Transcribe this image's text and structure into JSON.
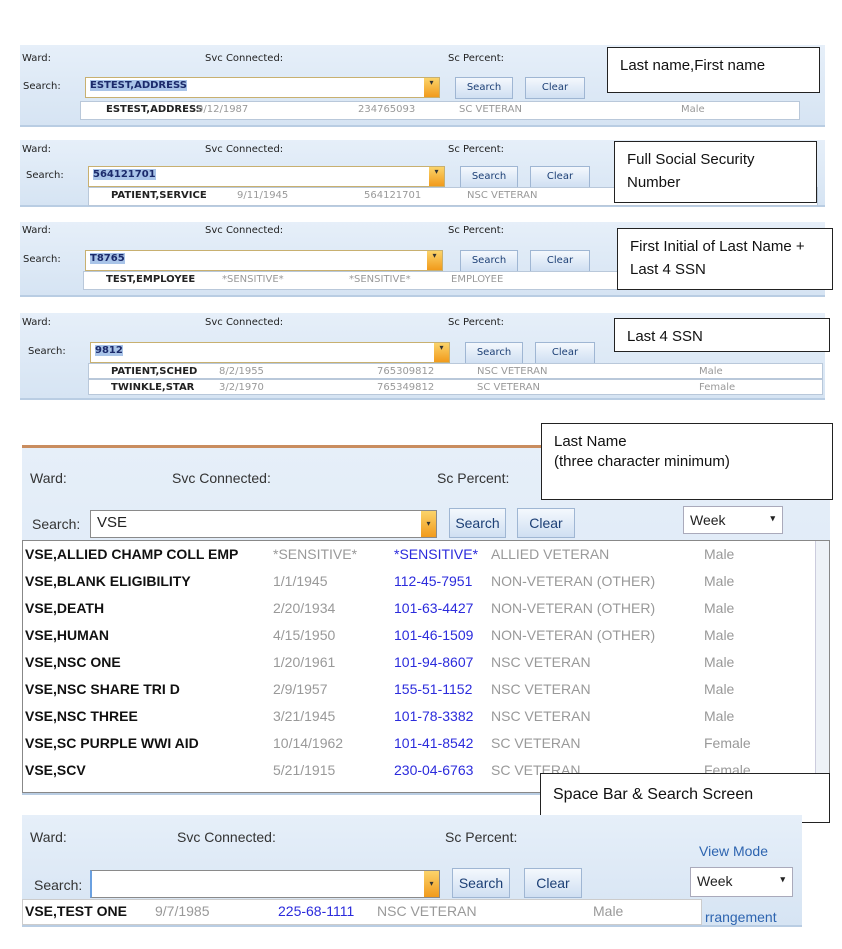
{
  "labels": {
    "ward": "Ward:",
    "svc": "Svc Connected:",
    "sc": "Sc Percent:",
    "search": "Search:",
    "search_btn": "Search",
    "clear_btn": "Clear",
    "dropdown_glyph": "▾"
  },
  "panels": [
    {
      "query": "ESTEST,ADDRESS",
      "callout": "Last name,First name",
      "results": [
        {
          "name": "ESTEST,ADDRESS",
          "dob": "9/12/1987",
          "ssn": "234765093",
          "type": "SC VETERAN",
          "gender": "Male"
        }
      ]
    },
    {
      "query": "564121701",
      "callout": "Full Social Security Number",
      "results": [
        {
          "name": "PATIENT,SERVICE",
          "dob": "9/11/1945",
          "ssn": "564121701",
          "type": "NSC VETERAN",
          "gender": ""
        }
      ]
    },
    {
      "query": "T8765",
      "callout": "First Initial of Last Name + Last 4 SSN",
      "results": [
        {
          "name": "TEST,EMPLOYEE",
          "dob": "*SENSITIVE*",
          "ssn": "*SENSITIVE*",
          "type": "EMPLOYEE",
          "gender": ""
        }
      ]
    },
    {
      "query": "9812",
      "callout": "Last 4 SSN",
      "results": [
        {
          "name": "PATIENT,SCHED",
          "dob": "8/2/1955",
          "ssn": "765309812",
          "type": "NSC VETERAN",
          "gender": "Male"
        },
        {
          "name": "TWINKLE,STAR",
          "dob": "3/2/1970",
          "ssn": "765349812",
          "type": "SC VETERAN",
          "gender": "Female"
        }
      ]
    }
  ],
  "big": {
    "query": "VSE",
    "view_value": "Week",
    "callout_top_line1": "Last Name",
    "callout_top_line2": "(three character minimum)",
    "callout_bottom": "Space Bar & Search Screen",
    "results": [
      {
        "name": "VSE,ALLIED CHAMP COLL EMP",
        "dob": "*SENSITIVE*",
        "ssn": "*SENSITIVE*",
        "type": "ALLIED VETERAN",
        "gender": "Male"
      },
      {
        "name": "VSE,BLANK ELIGIBILITY",
        "dob": "1/1/1945",
        "ssn": "112-45-7951",
        "type": "NON-VETERAN (OTHER)",
        "gender": "Male"
      },
      {
        "name": "VSE,DEATH",
        "dob": "2/20/1934",
        "ssn": "101-63-4427",
        "type": "NON-VETERAN (OTHER)",
        "gender": "Male"
      },
      {
        "name": "VSE,HUMAN",
        "dob": "4/15/1950",
        "ssn": "101-46-1509",
        "type": "NON-VETERAN (OTHER)",
        "gender": "Male"
      },
      {
        "name": "VSE,NSC ONE",
        "dob": "1/20/1961",
        "ssn": "101-94-8607",
        "type": "NSC VETERAN",
        "gender": "Male"
      },
      {
        "name": "VSE,NSC SHARE TRI D",
        "dob": "2/9/1957",
        "ssn": "155-51-1152",
        "type": "NSC VETERAN",
        "gender": "Male"
      },
      {
        "name": "VSE,NSC THREE",
        "dob": "3/21/1945",
        "ssn": "101-78-3382",
        "type": "NSC VETERAN",
        "gender": "Male"
      },
      {
        "name": "VSE,SC PURPLE WWI AID",
        "dob": "10/14/1962",
        "ssn": "101-41-8542",
        "type": "SC VETERAN",
        "gender": "Female"
      },
      {
        "name": "VSE,SCV",
        "dob": "5/21/1915",
        "ssn": "230-04-6763",
        "type": "SC VETERAN",
        "gender": "Female"
      }
    ]
  },
  "bottom": {
    "query": "",
    "view_mode_label": "View Mode",
    "view_value": "Week",
    "arrangement_label": "rrangement",
    "result": {
      "name": "VSE,TEST ONE",
      "dob": "9/7/1985",
      "ssn": "225-68-1111",
      "type": "NSC VETERAN",
      "gender": "Male"
    }
  },
  "colors": {
    "panel": "#dce8f6",
    "ssn_blue": "#2b2bdc",
    "dropdown_orange": "#f19a1c"
  }
}
